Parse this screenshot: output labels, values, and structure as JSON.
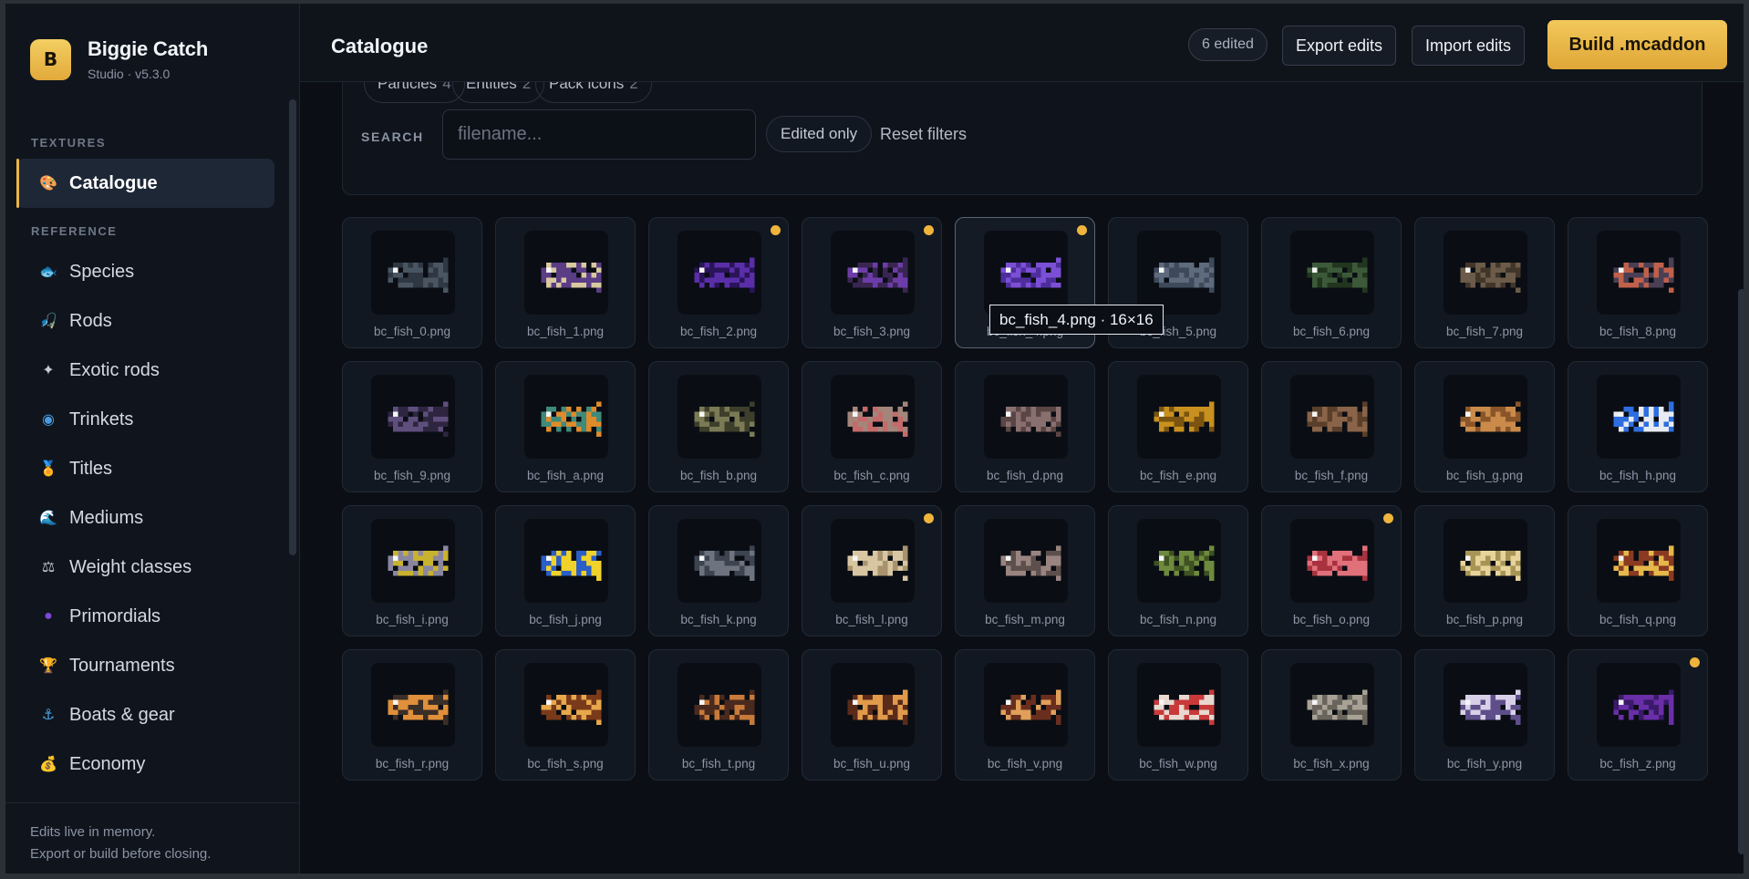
{
  "brand": {
    "logo_letter": "B",
    "name": "Biggie Catch",
    "subtitle": "Studio · v5.3.0",
    "accent": "#e9b446"
  },
  "sidebar": {
    "sections": [
      {
        "heading": "TEXTURES",
        "items": [
          {
            "label": "Catalogue",
            "icon": "palette-icon",
            "active": true
          }
        ]
      },
      {
        "heading": "REFERENCE",
        "items": [
          {
            "label": "Species",
            "icon": "fish-icon"
          },
          {
            "label": "Rods",
            "icon": "rod-icon"
          },
          {
            "label": "Exotic rods",
            "icon": "sparkle-icon"
          },
          {
            "label": "Trinkets",
            "icon": "trinket-icon"
          },
          {
            "label": "Titles",
            "icon": "medal-icon"
          },
          {
            "label": "Mediums",
            "icon": "wave-icon"
          },
          {
            "label": "Weight classes",
            "icon": "scale-icon"
          },
          {
            "label": "Primordials",
            "icon": "orb-icon"
          },
          {
            "label": "Tournaments",
            "icon": "trophy-icon"
          },
          {
            "label": "Boats & gear",
            "icon": "anchor-icon"
          },
          {
            "label": "Economy",
            "icon": "money-bag-icon"
          }
        ]
      }
    ],
    "footer": {
      "line1": "Edits live in memory.",
      "line2": "Export or build before closing."
    }
  },
  "header": {
    "title": "Catalogue",
    "edited_badge": "6 edited",
    "export_label": "Export edits",
    "import_label": "Import edits",
    "build_label": "Build .mcaddon"
  },
  "filters": {
    "chips": [
      {
        "label": "Particles",
        "count": "4"
      },
      {
        "label": "Entities",
        "count": "2"
      },
      {
        "label": "Pack icons",
        "count": "2"
      }
    ],
    "search_label": "SEARCH",
    "search_placeholder": "filename...",
    "search_value": "",
    "edited_only_label": "Edited only",
    "reset_label": "Reset filters"
  },
  "tooltip": "bc_fish_4.png · 16×16",
  "tiles": [
    {
      "name": "bc_fish_0.png",
      "edited": false,
      "colors": [
        "#4a5562",
        "#2f3742"
      ]
    },
    {
      "name": "bc_fish_1.png",
      "edited": false,
      "colors": [
        "#5b3d86",
        "#d9c9a0"
      ]
    },
    {
      "name": "bc_fish_2.png",
      "edited": true,
      "colors": [
        "#5a2ea8",
        "#2a145a"
      ]
    },
    {
      "name": "bc_fish_3.png",
      "edited": true,
      "colors": [
        "#3a2552",
        "#6c3da8"
      ]
    },
    {
      "name": "bc_fish_4.png",
      "edited": true,
      "hover": true,
      "colors": [
        "#7b4fd6",
        "#4e2e9c"
      ]
    },
    {
      "name": "bc_fish_5.png",
      "edited": false,
      "colors": [
        "#5d6b7d",
        "#3e4a5a"
      ]
    },
    {
      "name": "bc_fish_6.png",
      "edited": false,
      "colors": [
        "#3c5a3a",
        "#22361f"
      ]
    },
    {
      "name": "bc_fish_7.png",
      "edited": false,
      "colors": [
        "#6b5b48",
        "#423629"
      ]
    },
    {
      "name": "bc_fish_8.png",
      "edited": false,
      "colors": [
        "#4a3f55",
        "#c0604a"
      ]
    },
    {
      "name": "bc_fish_9.png",
      "edited": false,
      "colors": [
        "#5f4f7d",
        "#2e2540"
      ]
    },
    {
      "name": "bc_fish_a.png",
      "edited": false,
      "colors": [
        "#3f8a7a",
        "#e08a2a"
      ]
    },
    {
      "name": "bc_fish_b.png",
      "edited": false,
      "colors": [
        "#7a7a55",
        "#3e3f2a"
      ]
    },
    {
      "name": "bc_fish_c.png",
      "edited": false,
      "colors": [
        "#a3857a",
        "#c46a6a"
      ]
    },
    {
      "name": "bc_fish_d.png",
      "edited": false,
      "colors": [
        "#8a6f6f",
        "#5a4545"
      ]
    },
    {
      "name": "bc_fish_e.png",
      "edited": false,
      "colors": [
        "#c8901e",
        "#7a5410"
      ]
    },
    {
      "name": "bc_fish_f.png",
      "edited": false,
      "colors": [
        "#8a6448",
        "#5a3f2a"
      ]
    },
    {
      "name": "bc_fish_g.png",
      "edited": false,
      "colors": [
        "#c98a4a",
        "#8a5528"
      ]
    },
    {
      "name": "bc_fish_h.png",
      "edited": false,
      "colors": [
        "#2e6ee0",
        "#e8ecf2"
      ]
    },
    {
      "name": "bc_fish_i.png",
      "edited": false,
      "colors": [
        "#8a86a0",
        "#c9b22e"
      ]
    },
    {
      "name": "bc_fish_j.png",
      "edited": false,
      "colors": [
        "#f0d22a",
        "#2a5ec8"
      ]
    },
    {
      "name": "bc_fish_k.png",
      "edited": false,
      "colors": [
        "#6d7480",
        "#3d4450"
      ]
    },
    {
      "name": "bc_fish_l.png",
      "edited": true,
      "colors": [
        "#d8c6a2",
        "#a8936e"
      ]
    },
    {
      "name": "bc_fish_m.png",
      "edited": false,
      "colors": [
        "#9a8480",
        "#5d4f4c"
      ]
    },
    {
      "name": "bc_fish_n.png",
      "edited": false,
      "colors": [
        "#6e8a3e",
        "#3e5222"
      ]
    },
    {
      "name": "bc_fish_o.png",
      "edited": true,
      "colors": [
        "#e0707a",
        "#a8323e"
      ]
    },
    {
      "name": "bc_fish_p.png",
      "edited": false,
      "colors": [
        "#e6d49a",
        "#a89455"
      ]
    },
    {
      "name": "bc_fish_q.png",
      "edited": false,
      "colors": [
        "#8a3a22",
        "#e6b84a"
      ]
    },
    {
      "name": "bc_fish_r.png",
      "edited": false,
      "colors": [
        "#3a2e28",
        "#e0903a"
      ]
    },
    {
      "name": "bc_fish_s.png",
      "edited": false,
      "colors": [
        "#7a3a1a",
        "#e6a84a"
      ]
    },
    {
      "name": "bc_fish_t.png",
      "edited": false,
      "colors": [
        "#4a2a1e",
        "#c87a3a"
      ]
    },
    {
      "name": "bc_fish_u.png",
      "edited": false,
      "colors": [
        "#5a2a1a",
        "#e09a4a"
      ]
    },
    {
      "name": "bc_fish_v.png",
      "edited": false,
      "colors": [
        "#6a2e1e",
        "#e0a05a"
      ]
    },
    {
      "name": "bc_fish_w.png",
      "edited": false,
      "colors": [
        "#c83a3a",
        "#e8d8d0"
      ]
    },
    {
      "name": "bc_fish_x.png",
      "edited": false,
      "colors": [
        "#a8a296",
        "#6a655c"
      ]
    },
    {
      "name": "bc_fish_y.png",
      "edited": false,
      "colors": [
        "#5e4f8a",
        "#d8d0e8"
      ]
    },
    {
      "name": "bc_fish_z.png",
      "edited": true,
      "colors": [
        "#6a2ea8",
        "#3a1a6a"
      ]
    }
  ]
}
